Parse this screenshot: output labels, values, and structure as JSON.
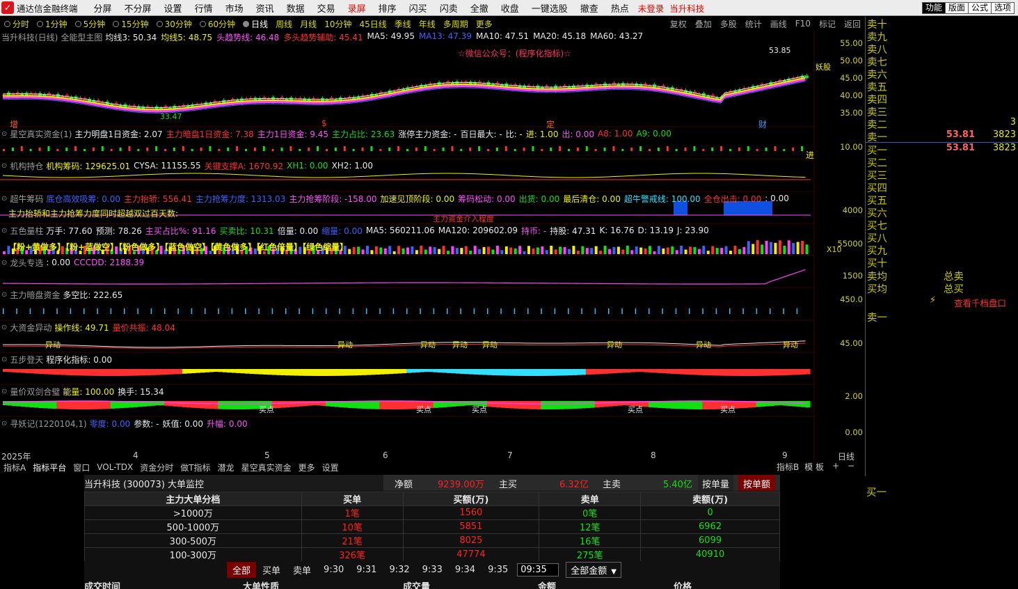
{
  "app": {
    "title": "通达信金融终端",
    "logo_color": "#d8141c"
  },
  "menu": {
    "items": [
      "分屏",
      "不分屏",
      "设置",
      "行情",
      "市场",
      "资讯",
      "数据",
      "交易",
      "录屏",
      "排序",
      "闪买",
      "闪卖",
      "全撤",
      "收盘",
      "一键选股",
      "撤查",
      "热点"
    ],
    "login_status": "未登录",
    "stock_name": "当升科技",
    "right_buttons": [
      "功能",
      "版面",
      "公式",
      "选项"
    ]
  },
  "periods": {
    "items": [
      "分时",
      "1分钟",
      "5分钟",
      "15分钟",
      "30分钟",
      "60分钟",
      "日线",
      "周线",
      "月线",
      "10分钟",
      "45日线",
      "季线",
      "年线",
      "多周期",
      "更多"
    ],
    "selected": "日线",
    "right_items": [
      "复权",
      "叠加",
      "多股",
      "统计",
      "画线",
      "F10",
      "标记",
      "返回"
    ]
  },
  "main_chart": {
    "title": "当升科技(日线)",
    "formula": "全能型主图",
    "vals": [
      {
        "t": "均线3: 50.34",
        "c": "#e8e8e8"
      },
      {
        "t": "均线5: 48.75",
        "c": "#f0f000"
      },
      {
        "t": "头趋势线: 46.48",
        "c": "#ff50ff"
      },
      {
        "t": "多头趋势辅助: 45.41",
        "c": "#ff3030"
      },
      {
        "t": "MA5: 49.95",
        "c": "#e8e8e8"
      },
      {
        "t": "MA13: 47.39",
        "c": "#4060ff"
      },
      {
        "t": "MA10: 47.51",
        "c": "#e8e8e8"
      },
      {
        "t": "MA20: 45.18",
        "c": "#e8e8e8"
      },
      {
        "t": "MA60: 43.27",
        "c": "#e8e8e8"
      }
    ],
    "watermark": "☆微信公众号：(程序化指标)☆",
    "high_label": "53.85",
    "low_label": "33.47",
    "monster_label": "妖股",
    "axis": [
      "55.00",
      "50.00",
      "45.00",
      "40.00",
      "35.00"
    ],
    "events": [
      "增",
      "$",
      "定",
      "财"
    ]
  },
  "indicators": [
    {
      "name": "星空真实资金(1)",
      "vals": [
        {
          "t": "主力明盘1日资金: 2.07",
          "c": "#e8e8e8"
        },
        {
          "t": "主力暗盘1日资金: 7.38",
          "c": "#ff3030"
        },
        {
          "t": "主力1日资金: 9.45",
          "c": "#ff50ff"
        },
        {
          "t": "主力占比: 23.63",
          "c": "#10e010"
        },
        {
          "t": "涨停主力资金: -",
          "c": "#e8e8e8"
        },
        {
          "t": "百日最大: -",
          "c": "#e8e8e8"
        },
        {
          "t": "比: -",
          "c": "#e8e8e8"
        },
        {
          "t": "进: 1.00",
          "c": "#f0f000"
        },
        {
          "t": "出: 0.00",
          "c": "#ff50ff"
        },
        {
          "t": "A8: 1.00",
          "c": "#ff3030"
        },
        {
          "t": "A9: 0.00",
          "c": "#10e010"
        }
      ],
      "axis": "10.00",
      "tag": "进"
    },
    {
      "name": "机构持仓",
      "vals": [
        {
          "t": "机构筹码: 129625.01",
          "c": "#f0f000"
        },
        {
          "t": "CYSA: 11155.55",
          "c": "#e8e8e8"
        },
        {
          "t": "关键支撑A: 1670.92",
          "c": "#ff3030"
        },
        {
          "t": "XH1: 0.00",
          "c": "#10e010"
        },
        {
          "t": "XH2: 1.00",
          "c": "#e8e8e8"
        }
      ],
      "axis": ""
    },
    {
      "name": "超牛筹码",
      "vals": [
        {
          "t": "底仓高效吸筹: 0.00",
          "c": "#4060ff"
        },
        {
          "t": "主力抬轿: 556.41",
          "c": "#ff3030"
        },
        {
          "t": "主力抢筹力度: 1313.03",
          "c": "#4060ff"
        },
        {
          "t": "主力抢筹阶段: -158.00",
          "c": "#ff50ff"
        },
        {
          "t": "加速见顶阶段: 0.00",
          "c": "#f0f000"
        },
        {
          "t": "筹码松动: 0.00",
          "c": "#ff50ff"
        },
        {
          "t": "出货: 0.00",
          "c": "#10e010"
        },
        {
          "t": "最后清仓: 0.00",
          "c": "#f0f000"
        },
        {
          "t": "超牛警戒线: 100.00",
          "c": "#30e0ff"
        },
        {
          "t": "全仓出击: 0.00",
          "c": "#ff3030"
        },
        {
          "t": ": 0.00",
          "c": "#e8e8e8"
        }
      ],
      "axis": "4000",
      "overlay": "主力抬轿和主力抢筹力度同时超越双过百天数:",
      "overlay2": "主力资金介入程度"
    },
    {
      "name": "五色量柱",
      "vals": [
        {
          "t": "万手: 77.60",
          "c": "#e8e8e8"
        },
        {
          "t": "预测: 78.26",
          "c": "#e8e8e8"
        },
        {
          "t": "主买占比%: 91.16",
          "c": "#ff50ff"
        },
        {
          "t": "买卖比: 10.31",
          "c": "#10e010"
        },
        {
          "t": "倍量: 0.00",
          "c": "#e8e8e8"
        },
        {
          "t": "缩量: 0.00",
          "c": "#4060ff"
        },
        {
          "t": "MA5: 560211.06",
          "c": "#e8e8e8"
        },
        {
          "t": "MA120: 209602.09",
          "c": "#e8e8e8"
        },
        {
          "t": "持币: -",
          "c": "#ff50ff"
        },
        {
          "t": "持股: 47.31",
          "c": "#e8e8e8"
        },
        {
          "t": "K: 16.76",
          "c": "#e8e8e8"
        },
        {
          "t": "D: 13.19",
          "c": "#e8e8e8"
        },
        {
          "t": "J: 23.90",
          "c": "#e8e8e8"
        }
      ],
      "legend": "【粉+黄做多】【粉+蓝做空】【粉色做多】【蓝色做空】【黄色做多】【红色倍量】【绿色缩量】",
      "axis": "55000",
      "axis2": "X10"
    },
    {
      "name": "龙头专选",
      "vals": [
        {
          "t": ": 0.00",
          "c": "#e8e8e8"
        },
        {
          "t": "CCCDD: 2188.39",
          "c": "#ff50ff"
        }
      ],
      "axis": "1500"
    },
    {
      "name": "主力暗盘资金",
      "vals": [
        {
          "t": "多空比: 222.65",
          "c": "#e8e8e8"
        }
      ],
      "axis": "450.0"
    },
    {
      "name": "大资金异动",
      "vals": [
        {
          "t": "操作线: 49.71",
          "c": "#f0f000"
        },
        {
          "t": "量价共振: 48.04",
          "c": "#ff3030"
        }
      ],
      "axis": "45.00",
      "labels": "异动"
    },
    {
      "name": "五步登天",
      "vals": [
        {
          "t": "程序化指标: 0.00",
          "c": "#e8e8e8"
        }
      ],
      "axis": ""
    },
    {
      "name": "量价双剑合璧",
      "vals": [
        {
          "t": "能量: 100.00",
          "c": "#f0f000"
        },
        {
          "t": "换手: 15.34",
          "c": "#e8e8e8"
        }
      ],
      "axis": "2.00",
      "labels": "买点"
    },
    {
      "name": "寻妖记(1220104,1)",
      "vals": [
        {
          "t": "零度: 0.00",
          "c": "#4060ff"
        },
        {
          "t": "参数: -",
          "c": "#e8e8e8"
        },
        {
          "t": "妖值: 0.00",
          "c": "#e8e8e8"
        },
        {
          "t": "升幅: 0.00",
          "c": "#ff50ff"
        }
      ],
      "axis": "0.00"
    }
  ],
  "xaxis": {
    "labels": [
      "2025年",
      "4",
      "5",
      "6",
      "7",
      "8",
      "9"
    ],
    "right": "日线"
  },
  "bottom_tabs": [
    "指标A",
    "指标平台",
    "窗口",
    "VOL-TDX",
    "资金分时",
    "做T指标",
    "潜龙",
    "星空真实资金",
    "更多",
    "设置"
  ],
  "bottom_right": [
    "指标B",
    "模 板",
    "+",
    "−"
  ],
  "orderbook": {
    "sell_labels": [
      "卖十",
      "卖九",
      "卖八",
      "卖七",
      "卖六",
      "卖五",
      "卖四",
      "卖三",
      "卖二",
      "卖一"
    ],
    "buy_labels": [
      "买一",
      "买二",
      "买三",
      "买四",
      "买五",
      "买六",
      "买七",
      "买八",
      "买九",
      "买十"
    ],
    "sell2_vol": "3",
    "sell1_price": "53.81",
    "sell1_vol": "3823",
    "buy1_price": "53.81",
    "buy1_vol": "3823",
    "avg_sell": "卖均",
    "avg_buy": "买均",
    "total_sell": "总卖",
    "total_buy": "总买",
    "thousand_link": "查看千档盘口",
    "extra_sell": "卖一",
    "extra_buy": "买一"
  },
  "bigorder": {
    "title": "当升科技 (300073) 大单监控",
    "net_label": "净额",
    "net_value": "9239.00万",
    "buy_label": "主买",
    "buy_value": "6.32亿",
    "sell_label": "主卖",
    "sell_value": "5.40亿",
    "btn_by_count": "按单量",
    "btn_by_amount": "按单额",
    "columns": [
      "主力大单分档",
      "买单",
      "买额(万)",
      "卖单",
      "卖额(万)"
    ],
    "rows": [
      [
        ">1000万",
        "1笔",
        "1560",
        "0笔",
        "0"
      ],
      [
        "500-1000万",
        "10笔",
        "5851",
        "12笔",
        "6962"
      ],
      [
        "300-500万",
        "21笔",
        "8025",
        "16笔",
        "6099"
      ],
      [
        "100-300万",
        "326笔",
        "47774",
        "275笔",
        "40910"
      ]
    ],
    "filters": [
      "全部",
      "买单",
      "卖单",
      "9:30",
      "9:31",
      "9:32",
      "9:33",
      "9:34",
      "9:35"
    ],
    "time_input": "09:35",
    "amount_select": "全部金额",
    "detail_cols": [
      "成交时间",
      "大单性质",
      "成交量",
      "金额",
      "价格"
    ]
  }
}
